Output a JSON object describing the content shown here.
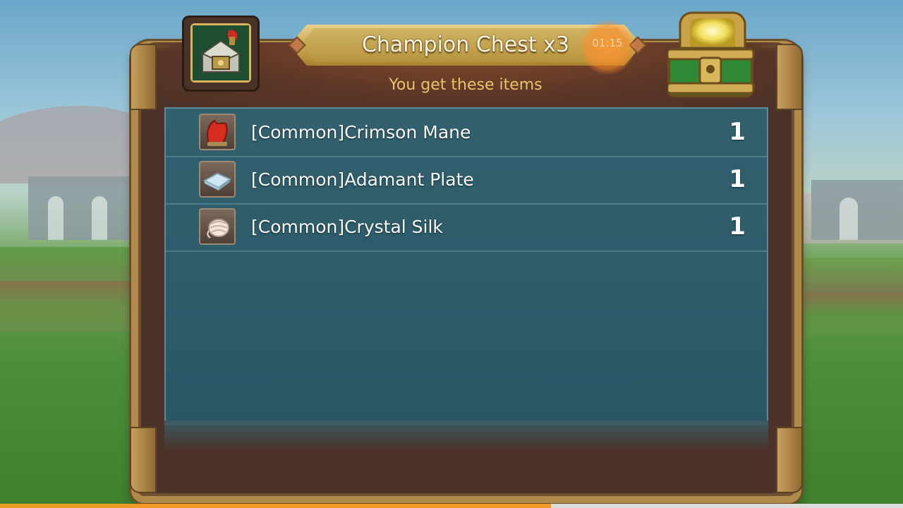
{
  "dialog": {
    "title": "Champion Chest x3",
    "timer": "01:15",
    "subtitle": "You get these items",
    "chest_icon": "chest-icon",
    "open_chest_icon": "open-treasure-chest-icon"
  },
  "items": [
    {
      "name": "[Common]Crimson Mane",
      "qty": "1",
      "icon": "crimson-mane-icon"
    },
    {
      "name": "[Common]Adamant Plate",
      "qty": "1",
      "icon": "adamant-plate-icon"
    },
    {
      "name": "[Common]Crystal Silk",
      "qty": "1",
      "icon": "crystal-silk-icon"
    }
  ],
  "video_progress": 0.61,
  "colors": {
    "frame_gold": "#b08a4a",
    "panel_brown": "#4c3228",
    "list_teal": "#2d5b6a",
    "subtitle_gold": "#e6c46a",
    "progress_orange": "#f39a25"
  }
}
